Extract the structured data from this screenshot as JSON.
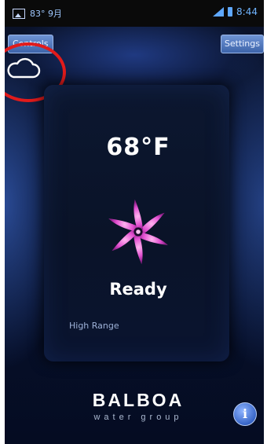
{
  "status_bar": {
    "left_text": "83° 9月",
    "time": "8:44"
  },
  "nav": {
    "controls_label": "Controls",
    "settings_label": "Settings"
  },
  "spa": {
    "temperature": "68°F",
    "status": "Ready",
    "range": "High Range"
  },
  "brand": {
    "name": "BALBOA",
    "tagline": "water group"
  },
  "colors": {
    "highlight": "#e21b1b",
    "logo_pink": "#e24fd0",
    "button_blue": "#3d64aa"
  },
  "icons": {
    "cloud": "cloud-icon",
    "info": "info-icon"
  }
}
